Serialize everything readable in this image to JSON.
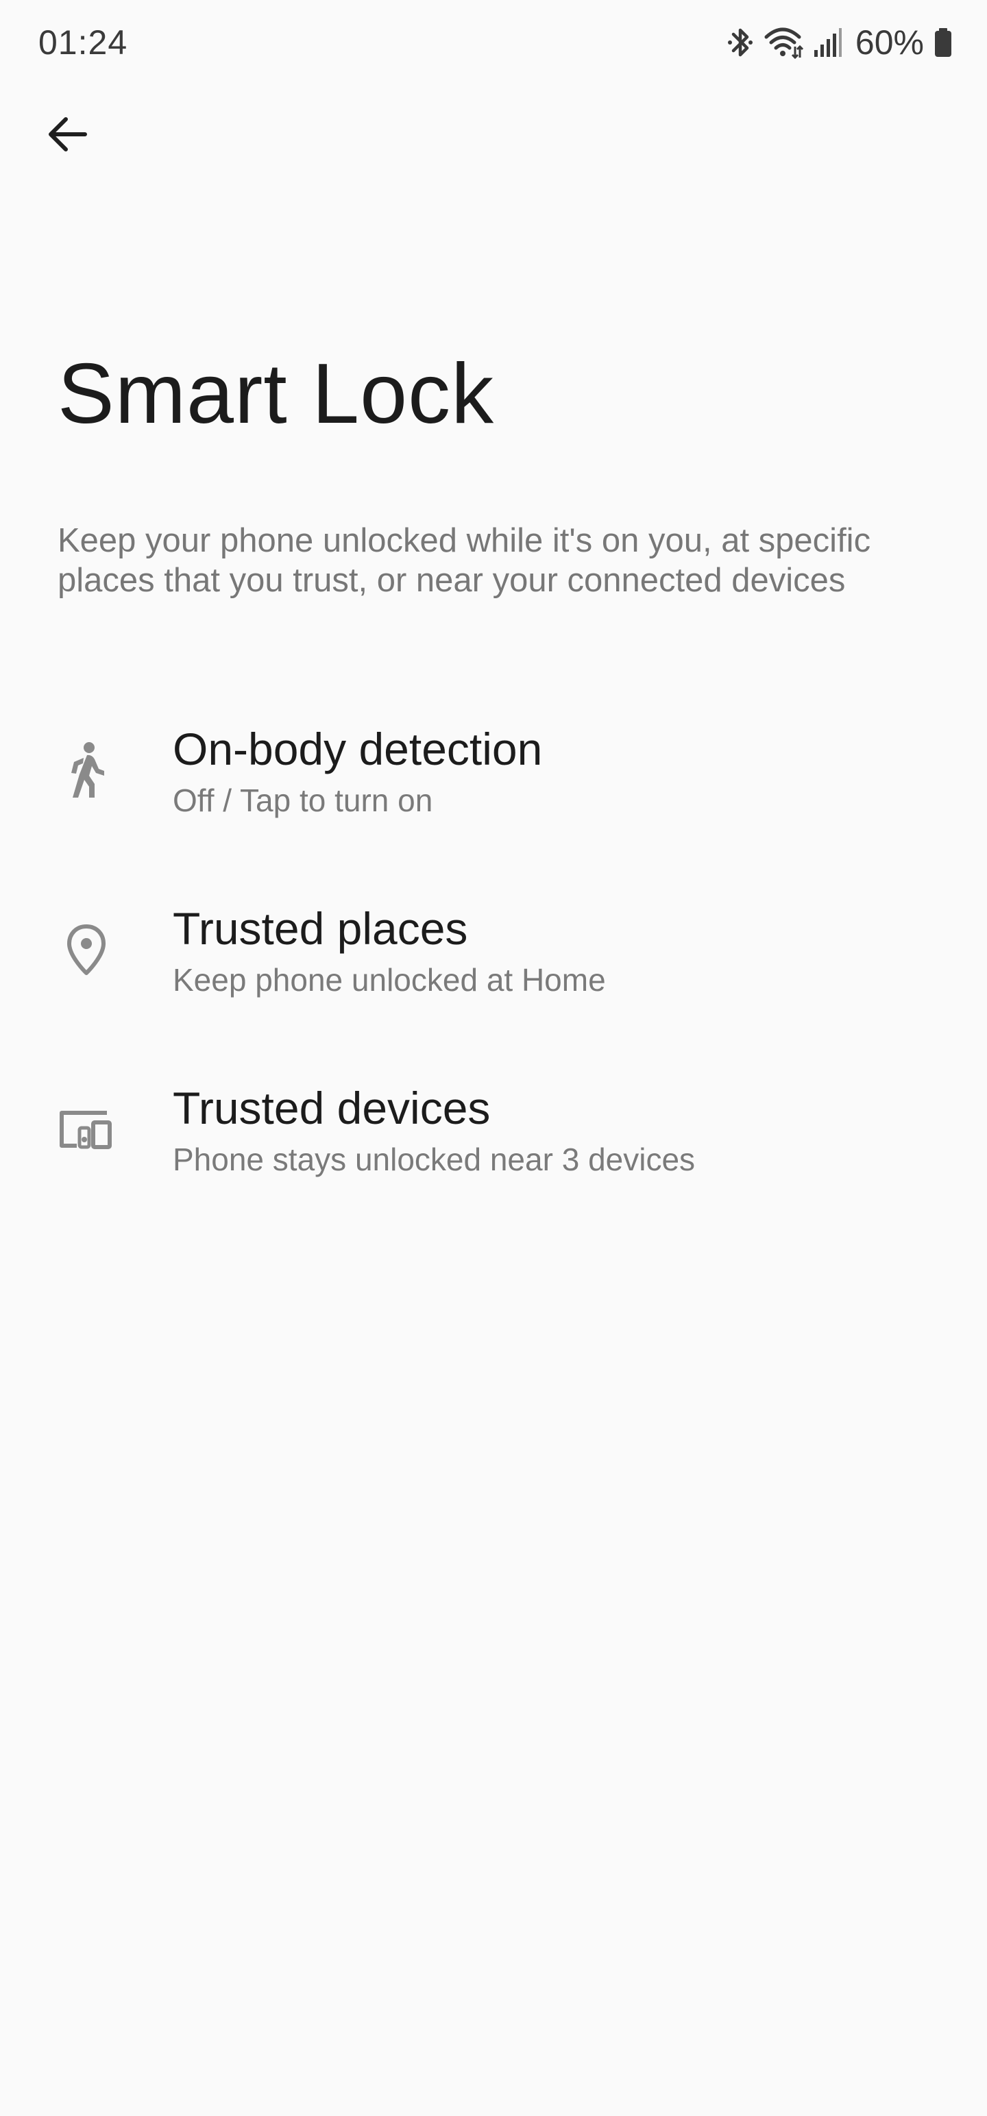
{
  "status_bar": {
    "time": "01:24",
    "battery_percent": "60%",
    "icons": [
      "bluetooth-icon",
      "wifi-icon",
      "signal-icon",
      "battery-icon"
    ],
    "battery_level": 0.6
  },
  "header": {
    "back_icon": "arrow-left-icon"
  },
  "page": {
    "title": "Smart Lock",
    "description": "Keep your phone unlocked while it's on you, at specific places that you trust, or near your connected devices"
  },
  "items": [
    {
      "title": "On-body detection",
      "subtitle": "Off / Tap to turn on",
      "icon": "walking-person-icon"
    },
    {
      "title": "Trusted places",
      "subtitle": "Keep phone unlocked at Home",
      "icon": "location-pin-icon"
    },
    {
      "title": "Trusted devices",
      "subtitle": "Phone stays unlocked near 3 devices",
      "icon": "devices-icon"
    }
  ],
  "colors": {
    "background": "#fafafa",
    "text_primary": "#1c1c1c",
    "text_secondary": "#777777",
    "icon": "#8a8a8a"
  }
}
